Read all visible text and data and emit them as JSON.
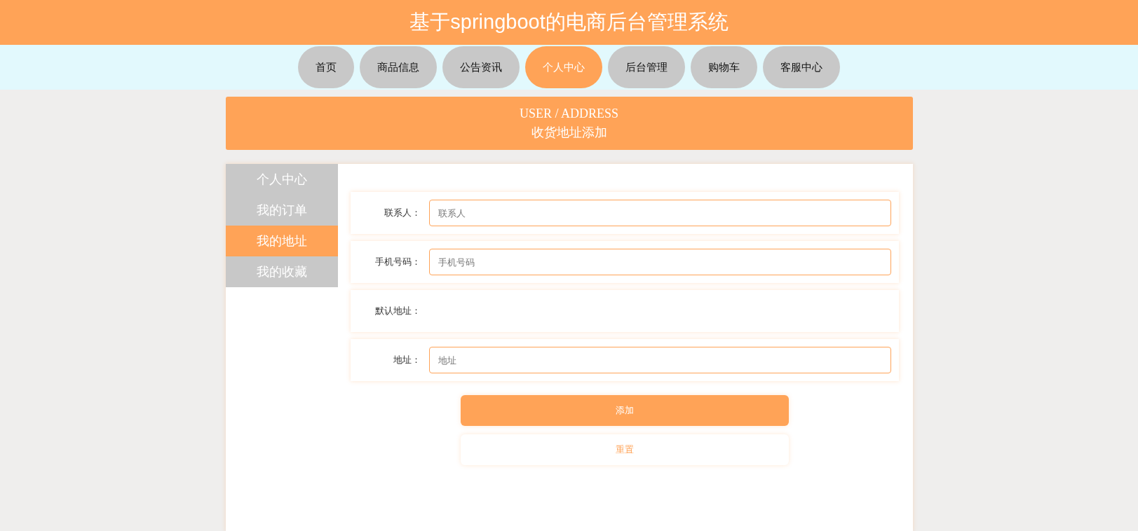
{
  "header": {
    "title": "基于springboot的电商后台管理系统"
  },
  "nav": [
    {
      "label": "首页",
      "selected": false
    },
    {
      "label": "商品信息",
      "selected": false
    },
    {
      "label": "公告资讯",
      "selected": false
    },
    {
      "label": "个人中心",
      "selected": true
    },
    {
      "label": "后台管理",
      "selected": false
    },
    {
      "label": "购物车",
      "selected": false
    },
    {
      "label": "客服中心",
      "selected": false
    }
  ],
  "banner": {
    "subtitle": "USER / ADDRESS",
    "title": "收货地址添加"
  },
  "sidebar": {
    "items": [
      {
        "label": "个人中心",
        "selected": false
      },
      {
        "label": "我的订单",
        "selected": false
      },
      {
        "label": "我的地址",
        "selected": true
      },
      {
        "label": "我的收藏",
        "selected": false
      }
    ]
  },
  "form": {
    "fields": [
      {
        "kind": "input",
        "label": "联系人：",
        "placeholder": "联系人"
      },
      {
        "kind": "input",
        "label": "手机号码：",
        "placeholder": "手机号码"
      },
      {
        "kind": "empty",
        "label": "默认地址："
      },
      {
        "kind": "input",
        "label": "地址：",
        "placeholder": "地址"
      }
    ],
    "buttons": [
      {
        "kind": "primary",
        "label": "添加"
      },
      {
        "kind": "secondary",
        "label": "重置"
      }
    ]
  }
}
